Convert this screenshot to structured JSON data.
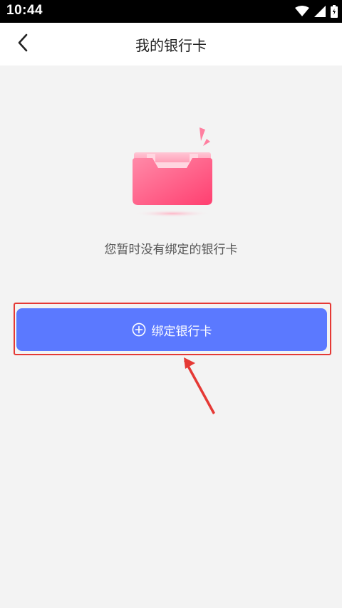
{
  "status_bar": {
    "time": "10:44",
    "icons": [
      "wifi-icon",
      "signal-icon",
      "battery-icon"
    ]
  },
  "header": {
    "back_icon": "chevron-left-icon",
    "title": "我的银行卡"
  },
  "empty_state": {
    "illustration": "empty-box-icon",
    "message": "您暂时没有绑定的银行卡"
  },
  "actions": {
    "bind_card_label": "绑定银行卡",
    "bind_card_icon": "plus-circle-icon"
  },
  "colors": {
    "primary_button": "#5b79ff",
    "highlight": "#e53935",
    "illustration_pink": "#ff4f7e",
    "background": "#f3f3f3"
  }
}
